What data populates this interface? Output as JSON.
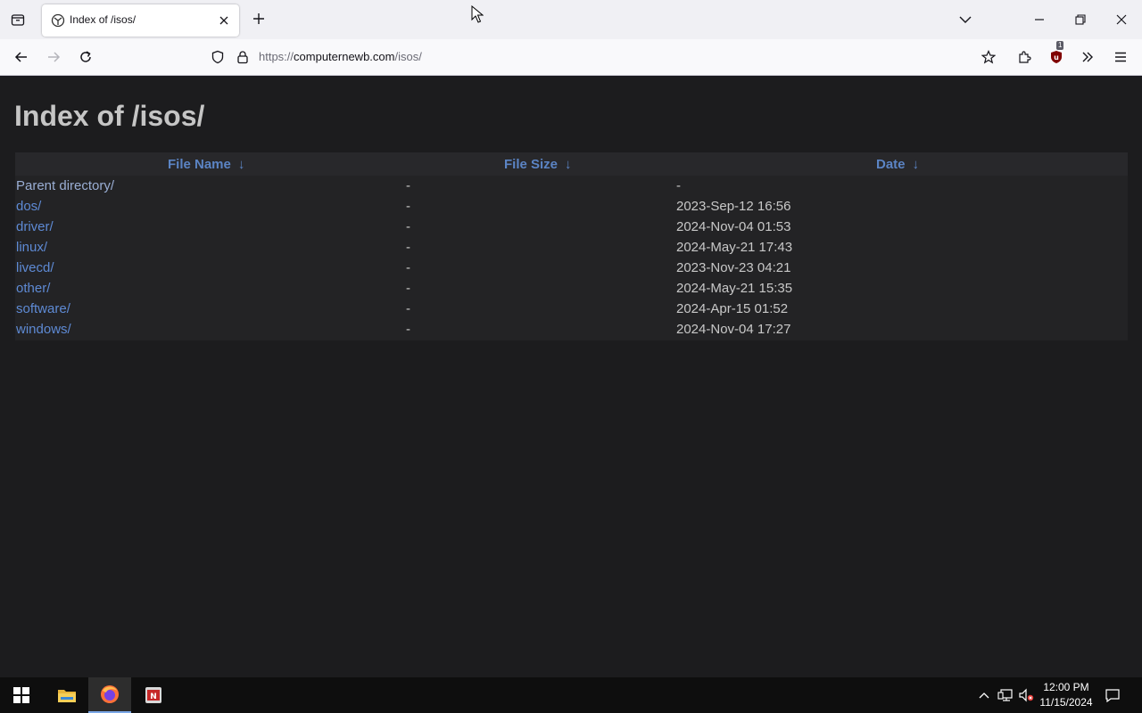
{
  "browser": {
    "tab": {
      "title": "Index of /isos/"
    },
    "url": {
      "scheme": "https://",
      "host": "computernewb.com",
      "path": "/isos/"
    },
    "extension_badge": "1"
  },
  "page": {
    "title": "Index of /isos/",
    "columns": [
      {
        "label": "File Name",
        "sort": "↓"
      },
      {
        "label": "File Size",
        "sort": "↓"
      },
      {
        "label": "Date",
        "sort": "↓"
      }
    ],
    "rows": [
      {
        "name": "Parent directory/",
        "size": "-",
        "date": "-"
      },
      {
        "name": "dos/",
        "size": "-",
        "date": "2023-Sep-12 16:56"
      },
      {
        "name": "driver/",
        "size": "-",
        "date": "2024-Nov-04 01:53"
      },
      {
        "name": "linux/",
        "size": "-",
        "date": "2024-May-21 17:43"
      },
      {
        "name": "livecd/",
        "size": "-",
        "date": "2023-Nov-23 04:21"
      },
      {
        "name": "other/",
        "size": "-",
        "date": "2024-May-21 15:35"
      },
      {
        "name": "software/",
        "size": "-",
        "date": "2024-Apr-15 01:52"
      },
      {
        "name": "windows/",
        "size": "-",
        "date": "2024-Nov-04 17:27"
      }
    ]
  },
  "taskbar": {
    "time": "12:00 PM",
    "date": "11/15/2024"
  },
  "colors": {
    "link": "#5e8ad4",
    "header": "#5b84c4",
    "page_bg": "#1c1c1e"
  }
}
